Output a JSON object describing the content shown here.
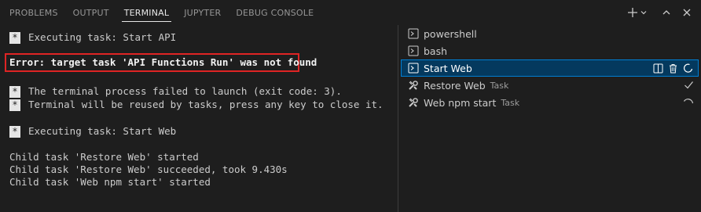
{
  "tabs": [
    {
      "label": "PROBLEMS"
    },
    {
      "label": "OUTPUT"
    },
    {
      "label": "TERMINAL"
    },
    {
      "label": "JUPYTER"
    },
    {
      "label": "DEBUG CONSOLE"
    }
  ],
  "active_tab": "TERMINAL",
  "terminal": {
    "star": "*",
    "line1": "Executing task: Start API",
    "error": "Error: target task 'API Functions Run' was not found",
    "line3": "The terminal process failed to launch (exit code: 3).",
    "line4": "Terminal will be reused by tasks, press any key to close it.",
    "line5": "Executing task: Start Web",
    "line6": "Child task 'Restore Web' started",
    "line7": "Child task 'Restore Web' succeeded, took 9.430s",
    "line8": "Child task 'Web npm start' started"
  },
  "terminal_list": [
    {
      "label": "powershell",
      "icon": "terminal-icon"
    },
    {
      "label": "bash",
      "icon": "terminal-icon"
    },
    {
      "label": "Start Web",
      "icon": "terminal-icon",
      "selected": true
    },
    {
      "label": "Restore Web",
      "description": "Task",
      "icon": "tools-icon",
      "status": "check-icon"
    },
    {
      "label": "Web npm start",
      "description": "Task",
      "icon": "tools-icon",
      "status": "loading-icon"
    }
  ],
  "colors": {
    "background": "#1e1e1e",
    "selection": "#04395e",
    "focus_border": "#007fd4",
    "error_highlight": "#e02424"
  }
}
